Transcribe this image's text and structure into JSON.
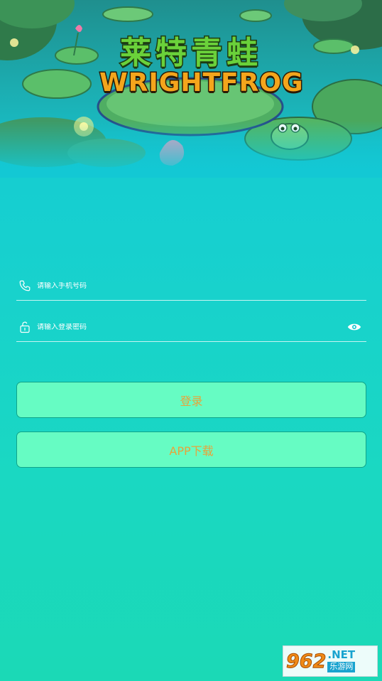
{
  "banner": {
    "logo_cn": "莱特青蛙",
    "logo_en": "WRIGHTFROG"
  },
  "form": {
    "phone": {
      "placeholder": "请输入手机号码",
      "icon": "phone-icon"
    },
    "password": {
      "placeholder": "请输入登录密码",
      "icon": "lock-icon",
      "toggle_icon": "eye-icon"
    }
  },
  "buttons": {
    "login": "登录",
    "download": "APP下载"
  },
  "watermark": {
    "number": "962",
    "net": ".NET",
    "cn": "乐游网"
  },
  "colors": {
    "accent_text": "#e8a33a",
    "button_bg": "#66fcc3",
    "background_top": "#13c8d4",
    "background_bottom": "#1bd9b6"
  }
}
